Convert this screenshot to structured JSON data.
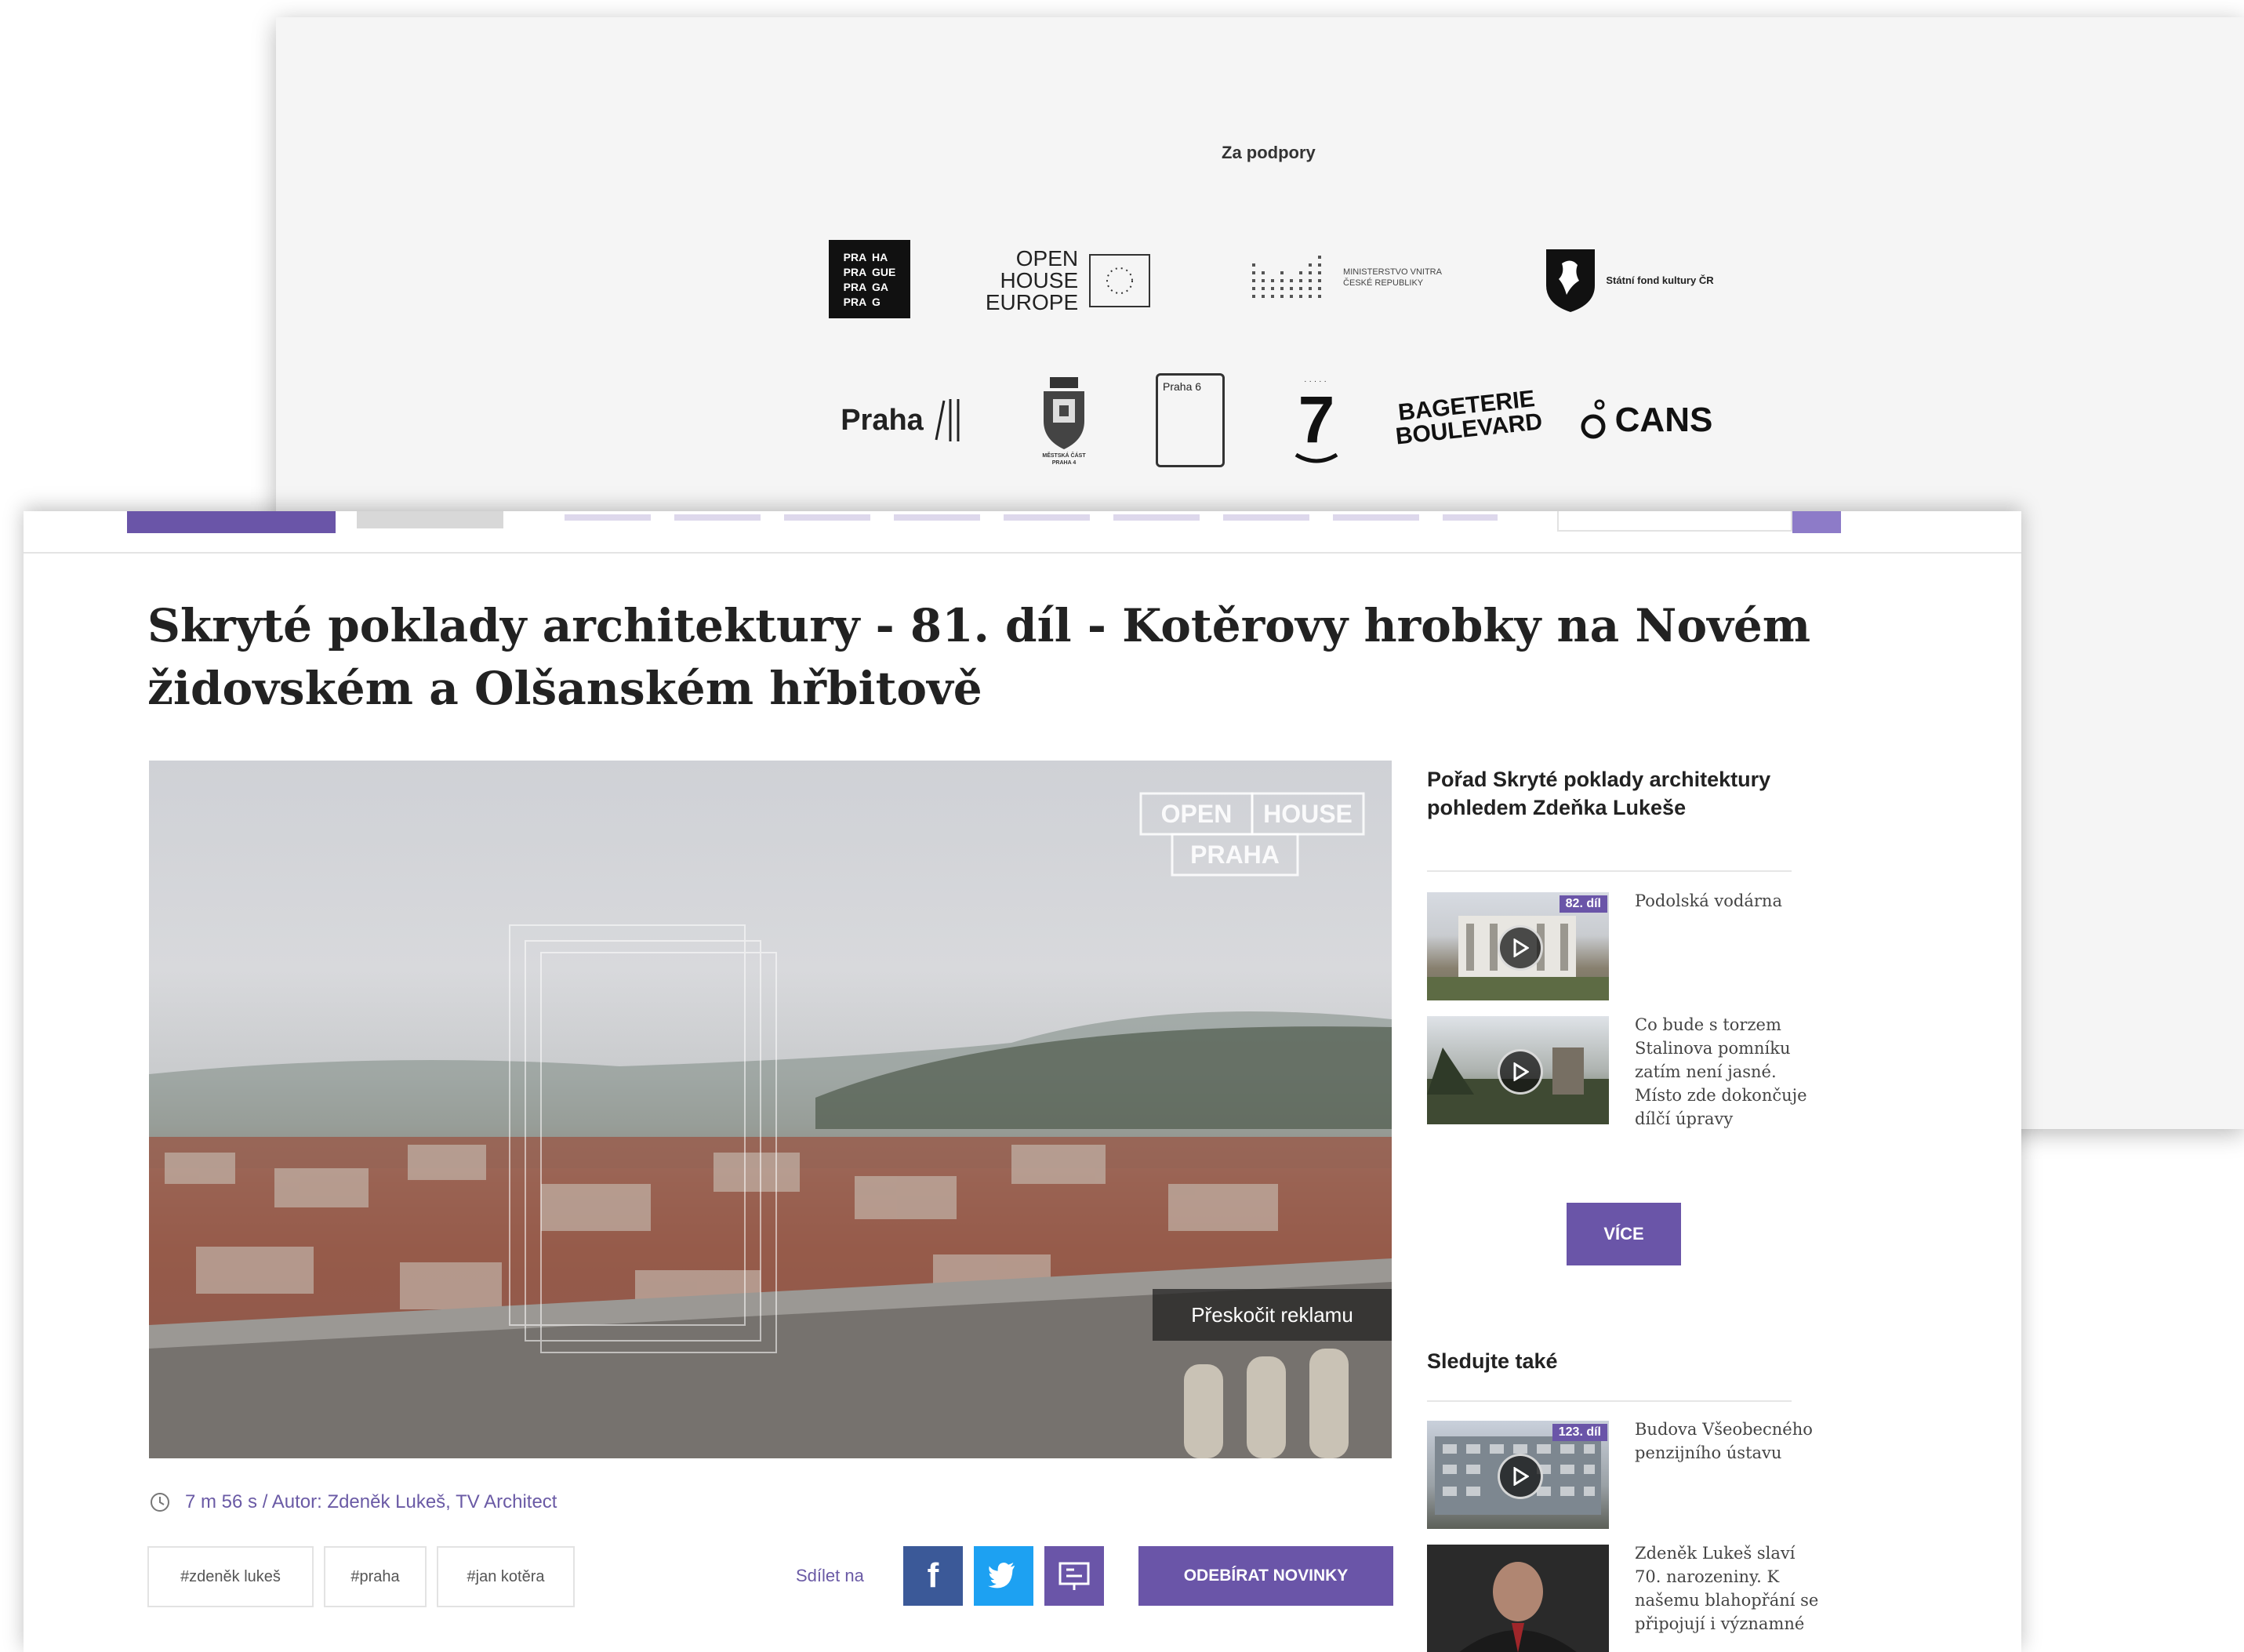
{
  "support": {
    "title": "Za podpory",
    "logos_row1": [
      {
        "name": "praha-logo",
        "text": [
          "PRA",
          "HA",
          "PRA",
          "GUE",
          "PRA",
          "GA",
          "PRA",
          "G"
        ]
      },
      {
        "name": "open-house-europe-logo",
        "text": [
          "OPEN",
          "HOUSE",
          "EUROPE"
        ]
      },
      {
        "name": "ministerstvo-vnitra-logo",
        "text": [
          "MINISTERSTVO VNITRA",
          "ČESKÉ REPUBLIKY"
        ]
      },
      {
        "name": "statni-fond-kultury-logo",
        "text": "Státní fond kultury ČR"
      }
    ],
    "logos_row2": [
      {
        "name": "praha-3-logo",
        "text": "Praha"
      },
      {
        "name": "praha-4-crest-logo",
        "text": [
          "MĚSTSKÁ ČÁST",
          "PRAHA 4"
        ]
      },
      {
        "name": "praha-6-logo",
        "text": "Praha 6"
      },
      {
        "name": "praha-7-logo",
        "text": "7"
      },
      {
        "name": "bageterie-boulevard-logo",
        "text": [
          "BAGETERIE",
          "BOULEVARD"
        ]
      },
      {
        "name": "cans-logo",
        "text": "CANS"
      }
    ]
  },
  "article": {
    "title": "Skryté poklady architektury - 81. díl - Kotěrovy hrobky na Novém židovském a Olšanském hřbitově",
    "video": {
      "watermark": [
        "OPEN",
        "HOUSE",
        "PRAHA"
      ],
      "skip_label": "Přeskočit reklamu"
    },
    "meta": "7 m 56 s / Autor: Zdeněk Lukeš, TV Architect",
    "tags": [
      "#zdeněk lukeš",
      "#praha",
      "#jan kotěra"
    ],
    "share_label": "Sdílet na",
    "subscribe_label": "ODEBÍRAT NOVINKY"
  },
  "sidebar": {
    "series_title": "Pořad Skryté poklady architektury pohledem Zdeňka Lukeše",
    "series_items": [
      {
        "badge": "82. díl",
        "text": "Podolská vodárna"
      },
      {
        "badge": "",
        "text": "Co bude s torzem Stalinova pomníku zatím není jasné. Místo zde dokončuje dílčí úpravy"
      }
    ],
    "more_label": "VÍCE",
    "watch_title": "Sledujte také",
    "watch_items": [
      {
        "badge": "123. díl",
        "text": "Budova Všeobecného penzijního ústavu"
      },
      {
        "badge": "",
        "text": "Zdeněk Lukeš slaví 70. narozeniny. K našemu blahopřání se připojují i významné"
      }
    ]
  },
  "colors": {
    "accent": "#6a55a8",
    "facebook": "#3b5998",
    "twitter": "#1da1f2"
  }
}
